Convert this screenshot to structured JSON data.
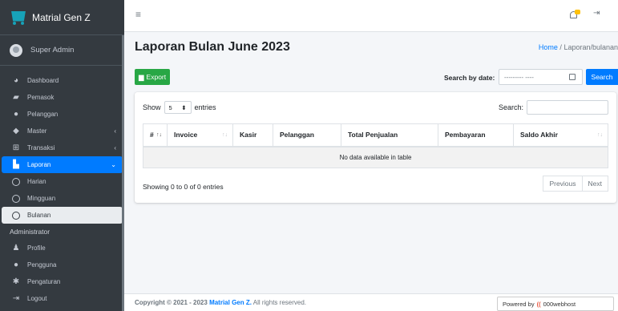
{
  "brand": {
    "name": "Matrial Gen Z"
  },
  "user": {
    "name": "Super Admin"
  },
  "sidebar": {
    "items": [
      {
        "label": "Dashboard"
      },
      {
        "label": "Pemasok"
      },
      {
        "label": "Pelanggan"
      },
      {
        "label": "Master"
      },
      {
        "label": "Transaksi"
      },
      {
        "label": "Laporan"
      },
      {
        "label": "Harian"
      },
      {
        "label": "Mingguan"
      },
      {
        "label": "Bulanan"
      }
    ],
    "header": "Administrator",
    "admin_items": [
      {
        "label": "Profile"
      },
      {
        "label": "Pengguna"
      },
      {
        "label": "Pengaturan"
      },
      {
        "label": "Logout"
      }
    ]
  },
  "page": {
    "title": "Laporan Bulan June 2023",
    "breadcrumb_home": "Home",
    "breadcrumb_sep": "/",
    "breadcrumb_current": "Laporan/bulanan"
  },
  "toolbar": {
    "export_label": "Export",
    "search_by_date_label": "Search by date:",
    "date_placeholder": "--------- ----",
    "search_label": "Search"
  },
  "table": {
    "show_label": "Show",
    "entries_label": "entries",
    "page_length": "5",
    "search_label": "Search:",
    "columns": [
      "#",
      "Invoice",
      "Kasir",
      "Pelanggan",
      "Total Penjualan",
      "Pembayaran",
      "Saldo Akhir"
    ],
    "empty_text": "No data available in table",
    "info": "Showing 0 to 0 of 0 entries",
    "prev_label": "Previous",
    "next_label": "Next"
  },
  "footer": {
    "prefix": "Copyright © 2021 - 2023",
    "brand": "Matrial Gen Z.",
    "suffix": "All rights reserved."
  },
  "powered": {
    "text": "Powered by",
    "brand": "000webhost"
  },
  "colors": {
    "primary": "#007bff",
    "success": "#28a745",
    "sidebar": "#343a40",
    "warning": "#ffc107"
  }
}
